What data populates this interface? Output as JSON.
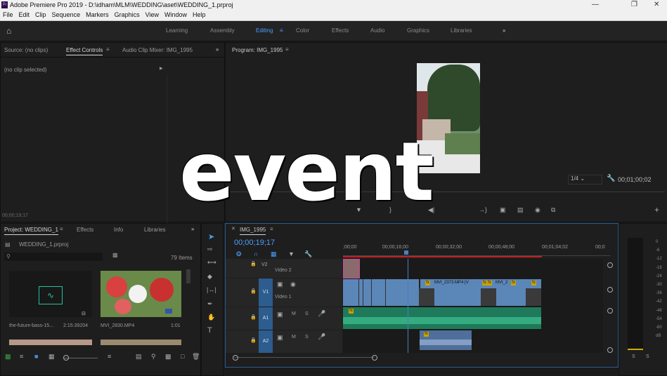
{
  "titlebar": {
    "title": "Adobe Premiere Pro 2019 - D:\\idham\\MLM\\WEDDING\\aset\\WEDDING_1.prproj",
    "app_icon": "Pr"
  },
  "menu": [
    "File",
    "Edit",
    "Clip",
    "Sequence",
    "Markers",
    "Graphics",
    "View",
    "Window",
    "Help"
  ],
  "workspaces": {
    "items": [
      "Learning",
      "Assembly",
      "Editing",
      "Color",
      "Effects",
      "Audio",
      "Graphics",
      "Libraries"
    ],
    "active": "Editing"
  },
  "source_panel": {
    "tab_source": "Source: (no clips)",
    "tab_effect_controls": "Effect Controls",
    "tab_audio_mixer": "Audio Clip Mixer: IMG_1995",
    "no_clip": "(no clip selected)",
    "timecode": "00;00;19;17"
  },
  "program_panel": {
    "tab": "Program: IMG_1995",
    "zoom_select": "1/4",
    "duration": "00;01;00;02"
  },
  "project_panel": {
    "tab_project": "Project: WEDDING_1",
    "tab_effects": "Effects",
    "tab_info": "Info",
    "tab_libraries": "Libraries",
    "file": "WEDDING_1.prproj",
    "count": "79 Items",
    "items": [
      {
        "name": "the-future-bass-15...",
        "duration": "2:15:39204"
      },
      {
        "name": "MVI_2830.MP4",
        "duration": "1:01"
      }
    ]
  },
  "timeline": {
    "tab": "IMG_1995",
    "timecode": "00;00;19;17",
    "ruler": [
      ";00;00",
      "00;00;16;00",
      "00;00;32;00",
      "00;00;48;00",
      "00;01;04;02",
      "00;0"
    ],
    "tracks": [
      {
        "id": "V2",
        "name": "Video 2"
      },
      {
        "id": "V1",
        "name": "Video 1"
      },
      {
        "id": "A1",
        "name": ""
      },
      {
        "id": "A2",
        "name": ""
      }
    ],
    "clips": [
      "MVI_2373.MP4 [V",
      "MVI_2"
    ],
    "track_buttons": {
      "m": "M",
      "s": "S"
    }
  },
  "meters": {
    "scale": [
      "0",
      "-6",
      "-12",
      "-18",
      "-24",
      "-30",
      "-36",
      "-42",
      "-48",
      "-54",
      "-60",
      "dB"
    ],
    "solo": [
      "S",
      "S"
    ]
  },
  "overlay_text": "event",
  "colors": {
    "accent_blue": "#4a9fff",
    "playhead": "#4a7fc0",
    "video_clip": "#5b86b8",
    "audio_clip": "#1e7a5a",
    "in_out": "#c02020"
  }
}
